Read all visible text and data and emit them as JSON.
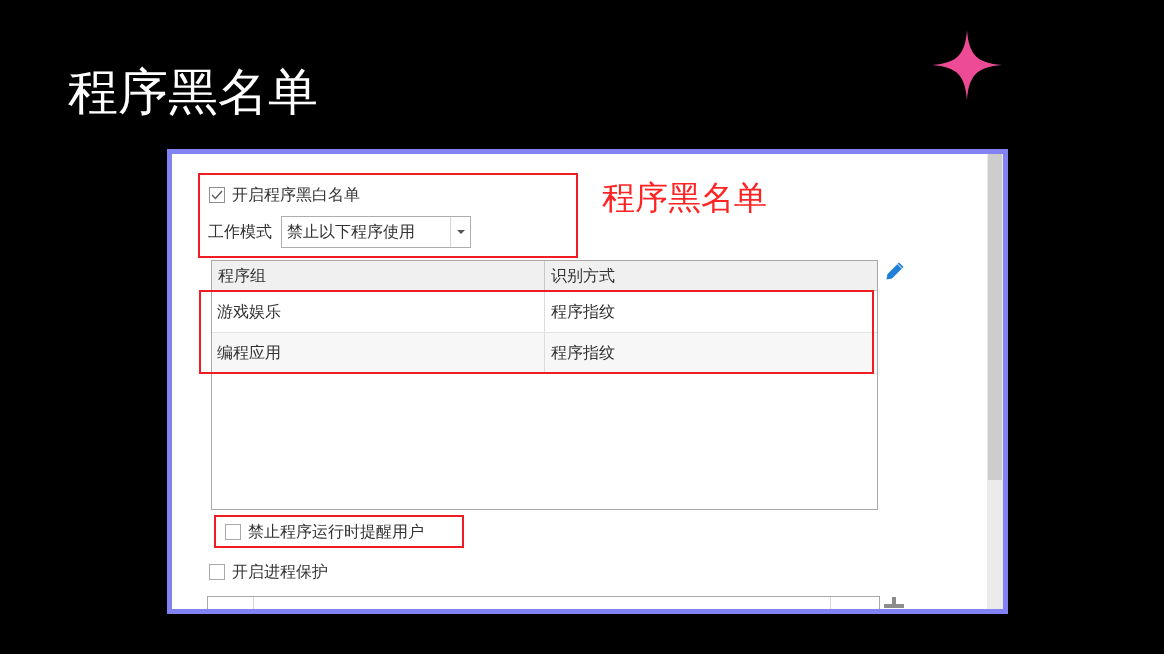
{
  "slide": {
    "title": "程序黑名单"
  },
  "panel": {
    "blacklist": {
      "highlighted": true,
      "enable": {
        "label": "开启程序黑白名单",
        "checked": true
      },
      "mode": {
        "label": "工作模式",
        "value": "禁止以下程序使用"
      }
    },
    "annotation": "程序黑名单",
    "table": {
      "columns": [
        "程序组",
        "识别方式"
      ],
      "rows_highlighted": true,
      "rows": [
        {
          "cells": [
            "游戏娱乐",
            "程序指纹"
          ]
        },
        {
          "cells": [
            "编程应用",
            "程序指纹"
          ]
        }
      ]
    },
    "options": [
      {
        "label": "禁止程序运行时提醒用户",
        "checked": false,
        "highlighted": true
      },
      {
        "label": "开启进程保护",
        "checked": false,
        "highlighted": false
      }
    ]
  }
}
